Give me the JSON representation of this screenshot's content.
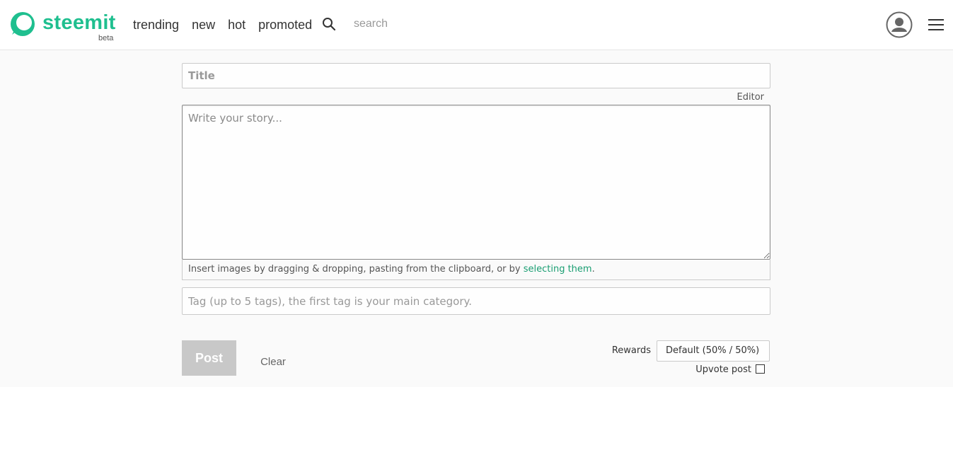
{
  "brand": {
    "name": "steemit",
    "badge": "beta",
    "color": "#1fbf8f"
  },
  "nav": {
    "items": [
      {
        "label": "trending"
      },
      {
        "label": "new"
      },
      {
        "label": "hot"
      },
      {
        "label": "promoted"
      }
    ]
  },
  "search": {
    "placeholder": "search",
    "icon": "search-icon"
  },
  "user": {
    "avatar_icon": "user-avatar-icon",
    "menu_icon": "hamburger-menu-icon"
  },
  "editor": {
    "title_placeholder": "Title",
    "mode_toggle": "Editor",
    "body_placeholder": "Write your story...",
    "insert_prefix": "Insert images by dragging & dropping, pasting from the clipboard, or by ",
    "insert_link": "selecting them",
    "insert_suffix": ".",
    "tags_placeholder": "Tag (up to 5 tags), the first tag is your main category."
  },
  "actions": {
    "post_label": "Post",
    "clear_label": "Clear",
    "rewards_label": "Rewards",
    "rewards_value": "Default (50% / 50%)",
    "upvote_label": "Upvote post",
    "upvote_checked": false
  },
  "colors": {
    "link": "#1a9e72",
    "post_button_disabled": "#c8c8c8",
    "page_background": "#fafafa"
  }
}
